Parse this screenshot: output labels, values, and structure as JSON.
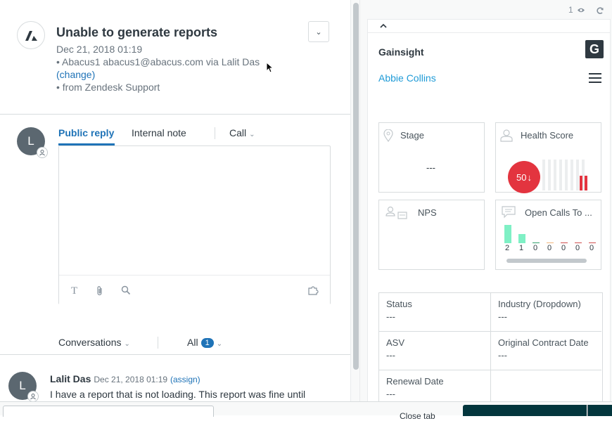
{
  "ticket": {
    "title": "Unable to generate reports",
    "date": "Dec 21, 2018 01:19",
    "requester_line": "• Abacus1   abacus1@abacus.com via Lalit Das",
    "change_link": "(change)",
    "source_line": "• from Zendesk Support"
  },
  "composer": {
    "avatar_initial": "L",
    "tabs": [
      {
        "label": "Public reply",
        "active": true
      },
      {
        "label": "Internal note",
        "active": false
      }
    ],
    "call_label": "Call",
    "toolbar_icons": [
      "text-format-icon",
      "attachment-icon",
      "search-icon",
      "puzzle-icon"
    ]
  },
  "conversations": {
    "filter_label": "Conversations",
    "all_label": "All",
    "all_count": "1"
  },
  "message": {
    "avatar_initial": "L",
    "author": "Lalit Das",
    "date": "Dec 21, 2018 01:19",
    "assign_link": "(assign)",
    "text": "I have a report that is not loading. This report was fine until"
  },
  "bottom_bar": {
    "close_tab_label": "Close tab"
  },
  "right_panel": {
    "viewers_count": "1",
    "app": {
      "title": "Gainsight",
      "logo_letter": "G",
      "customer_name": "Abbie Collins",
      "cards": {
        "stage": {
          "label": "Stage",
          "value": "---"
        },
        "health": {
          "label": "Health Score",
          "score": "50",
          "arrow": "↓"
        },
        "nps": {
          "label": "NPS"
        },
        "open_calls": {
          "label": "Open Calls To ...",
          "counts": [
            "2",
            "1",
            "0",
            "0",
            "0",
            "0",
            "0"
          ]
        }
      },
      "fields": [
        {
          "label": "Status",
          "value": "---"
        },
        {
          "label": "Industry (Dropdown)",
          "value": "---"
        },
        {
          "label": "ASV",
          "value": "---"
        },
        {
          "label": "Original Contract Date",
          "value": "---"
        },
        {
          "label": "Renewal Date",
          "value": "---"
        }
      ]
    }
  },
  "colors": {
    "accent_blue": "#1f73b7",
    "gainsight_link": "#1f9bd7",
    "health_red": "#e3343f",
    "calls_green": "#7ff0c5",
    "submit_dark": "#03363d"
  }
}
